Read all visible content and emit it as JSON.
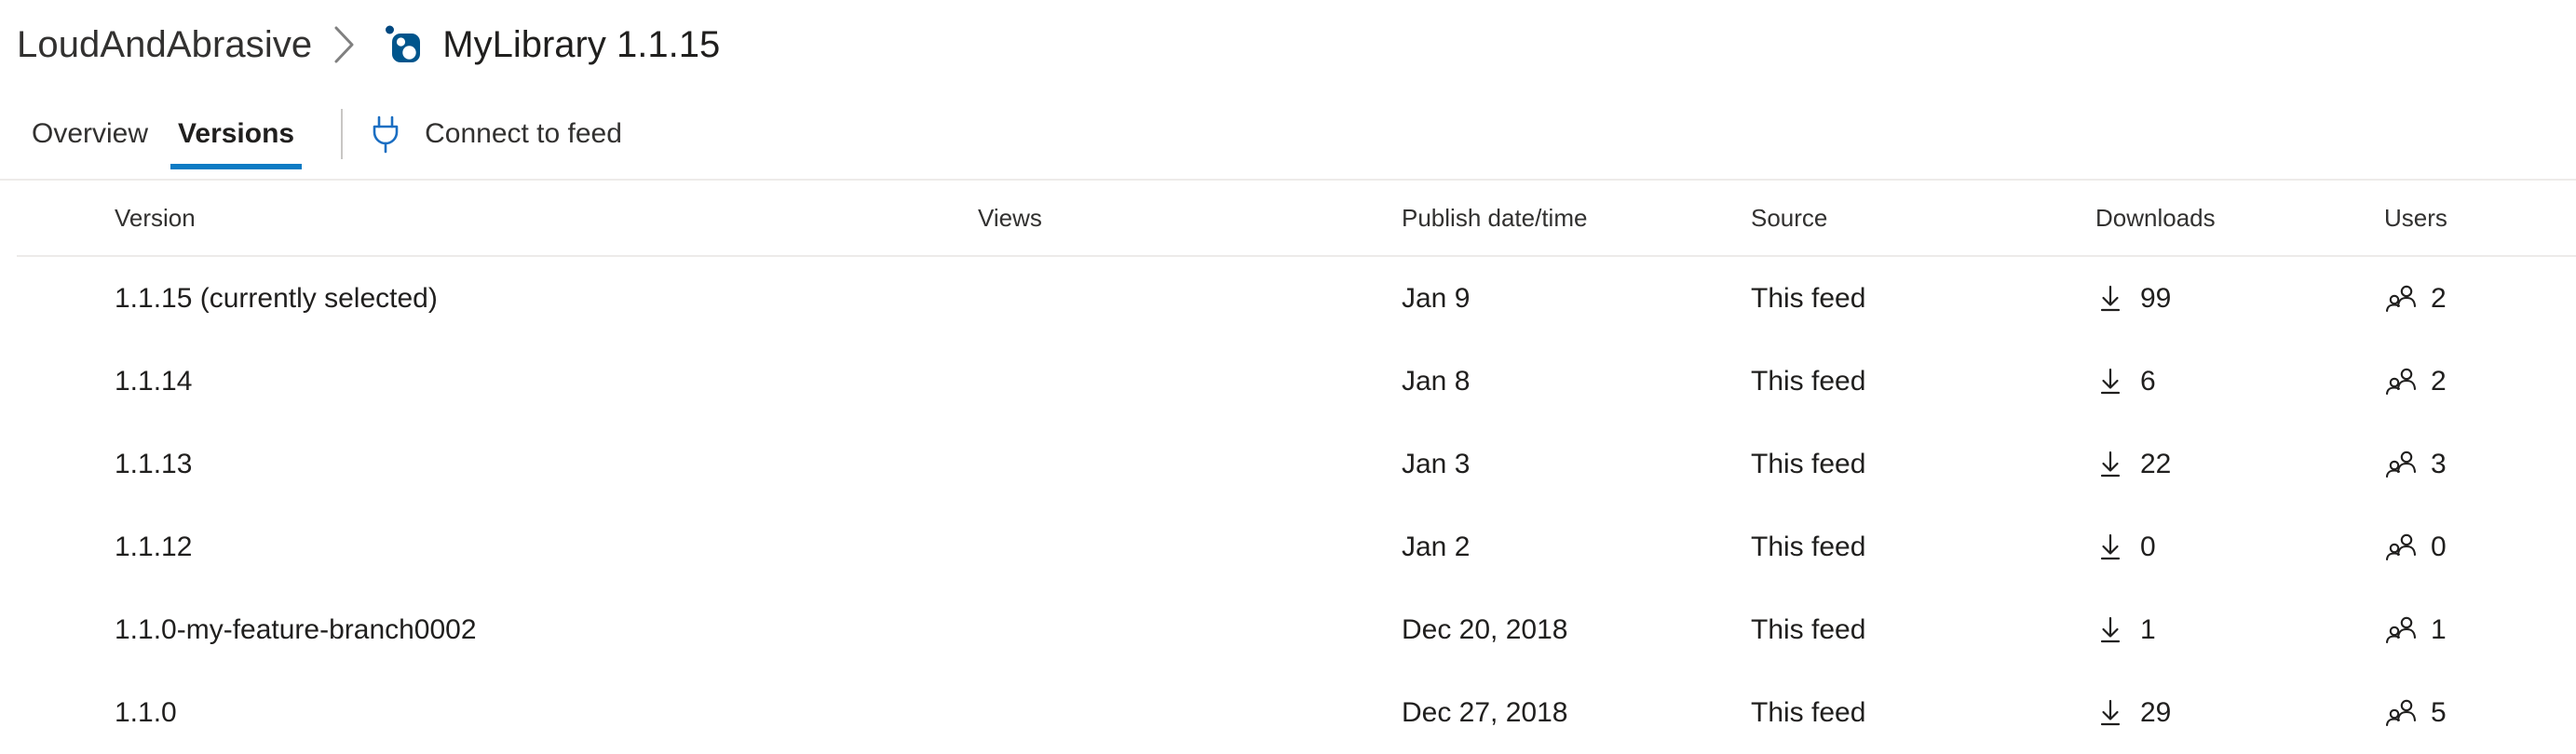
{
  "breadcrumb": {
    "feed_name": "LoudAndAbrasive",
    "separator": "chevron-right-icon",
    "package_icon": "nuget-package-icon",
    "current": "MyLibrary 1.1.15"
  },
  "tabs": [
    {
      "label": "Overview",
      "selected": false
    },
    {
      "label": "Versions",
      "selected": true
    }
  ],
  "toolbar": {
    "connect_icon": "plug-icon",
    "connect_label": "Connect to feed"
  },
  "table": {
    "columns": [
      {
        "key": "version",
        "label": "Version"
      },
      {
        "key": "views",
        "label": "Views"
      },
      {
        "key": "publish",
        "label": "Publish date/time"
      },
      {
        "key": "source",
        "label": "Source"
      },
      {
        "key": "downloads",
        "label": "Downloads"
      },
      {
        "key": "users",
        "label": "Users"
      }
    ],
    "download_icon": "download-arrow-icon",
    "users_icon": "people-icon",
    "rows": [
      {
        "version": "1.1.15 (currently selected)",
        "views": "",
        "publish": "Jan 9",
        "source": "This feed",
        "downloads": "99",
        "users": "2"
      },
      {
        "version": "1.1.14",
        "views": "",
        "publish": "Jan 8",
        "source": "This feed",
        "downloads": "6",
        "users": "2"
      },
      {
        "version": "1.1.13",
        "views": "",
        "publish": "Jan 3",
        "source": "This feed",
        "downloads": "22",
        "users": "3"
      },
      {
        "version": "1.1.12",
        "views": "",
        "publish": "Jan 2",
        "source": "This feed",
        "downloads": "0",
        "users": "0"
      },
      {
        "version": "1.1.0-my-feature-branch0002",
        "views": "",
        "publish": "Dec 20, 2018",
        "source": "This feed",
        "downloads": "1",
        "users": "1"
      },
      {
        "version": "1.1.0",
        "views": "",
        "publish": "Dec 27, 2018",
        "source": "This feed",
        "downloads": "29",
        "users": "5"
      }
    ]
  },
  "colors": {
    "accent": "#0d7bc4",
    "nuget_blue": "#004880",
    "text": "#201f1e",
    "muted_text": "#323130",
    "divider": "#edebe9",
    "tab_divider": "#c8c6c4",
    "background": "#ffffff"
  }
}
